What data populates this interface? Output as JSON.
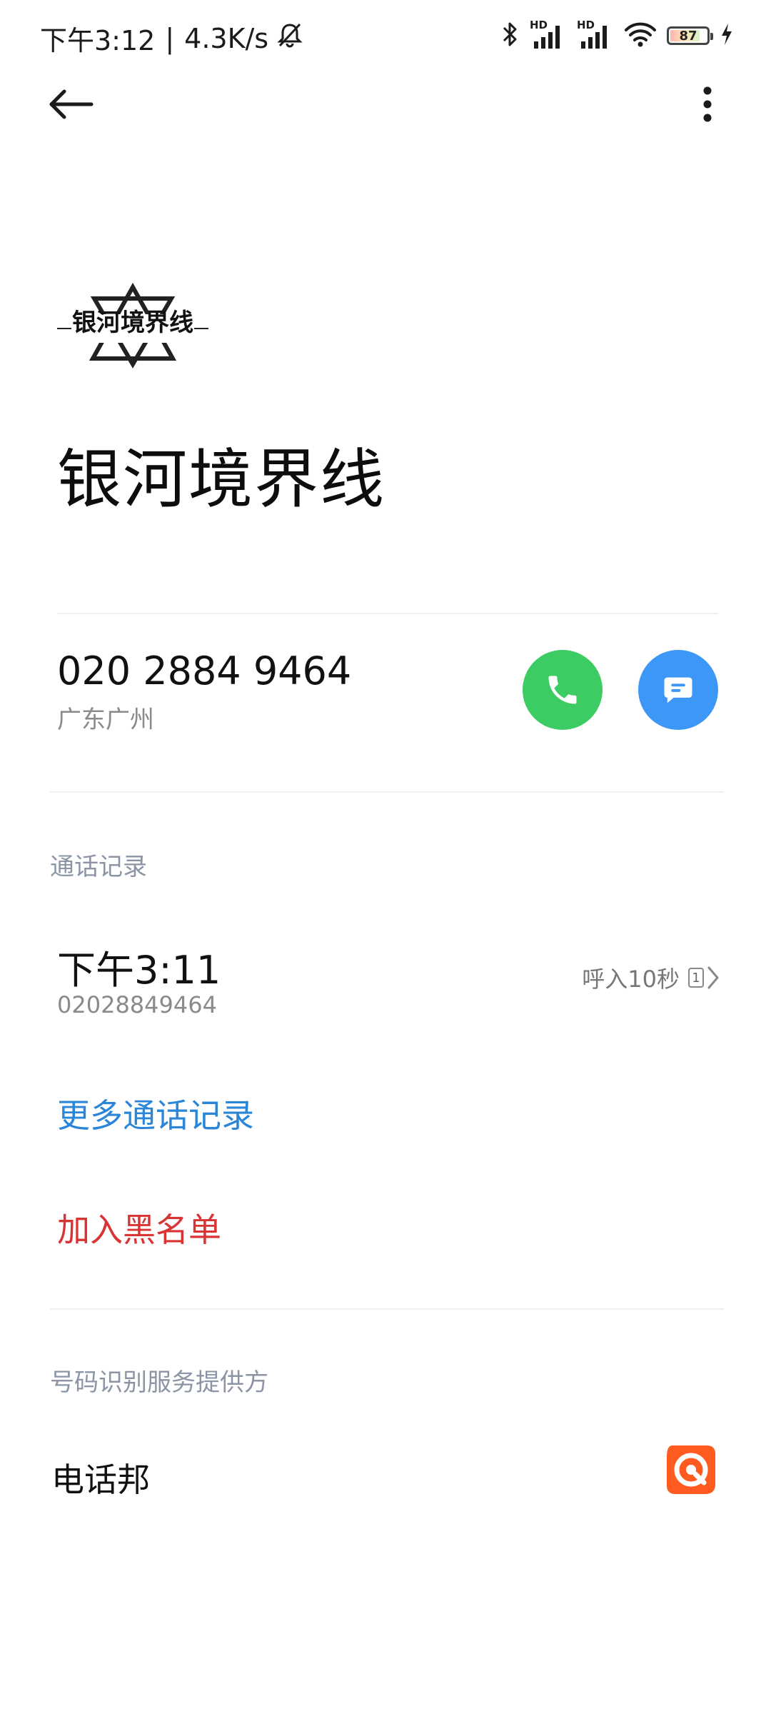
{
  "status_bar": {
    "time": "下午3:12",
    "separator": "|",
    "net_speed": "4.3K/s",
    "hd1": "HD",
    "hd2": "HD",
    "battery": "87",
    "icons": [
      "mute-bell-icon",
      "bluetooth-icon",
      "signal-icon",
      "signal-icon",
      "wifi-icon",
      "battery-icon",
      "charging-icon"
    ]
  },
  "toolbar": {
    "back_icon": "back-arrow-icon",
    "menu_icon": "more-vert-icon"
  },
  "contact": {
    "name": "银河境界线",
    "avatar_text": "银河境界线"
  },
  "phone": {
    "number": "020 2884 9464",
    "location": "广东广州",
    "call_color": "#3ccc63",
    "message_color": "#3d97f6"
  },
  "call_log": {
    "section_title": "通话记录",
    "entries": [
      {
        "time": "下午3:11",
        "number": "02028849464",
        "status": "呼入10秒",
        "sim": "1"
      }
    ],
    "more_label": "更多通话记录"
  },
  "actions": {
    "blacklist_label": "加入黑名单"
  },
  "provider": {
    "section_title": "号码识别服务提供方",
    "name": "电话邦",
    "logo_color": "#ff5a1f"
  }
}
